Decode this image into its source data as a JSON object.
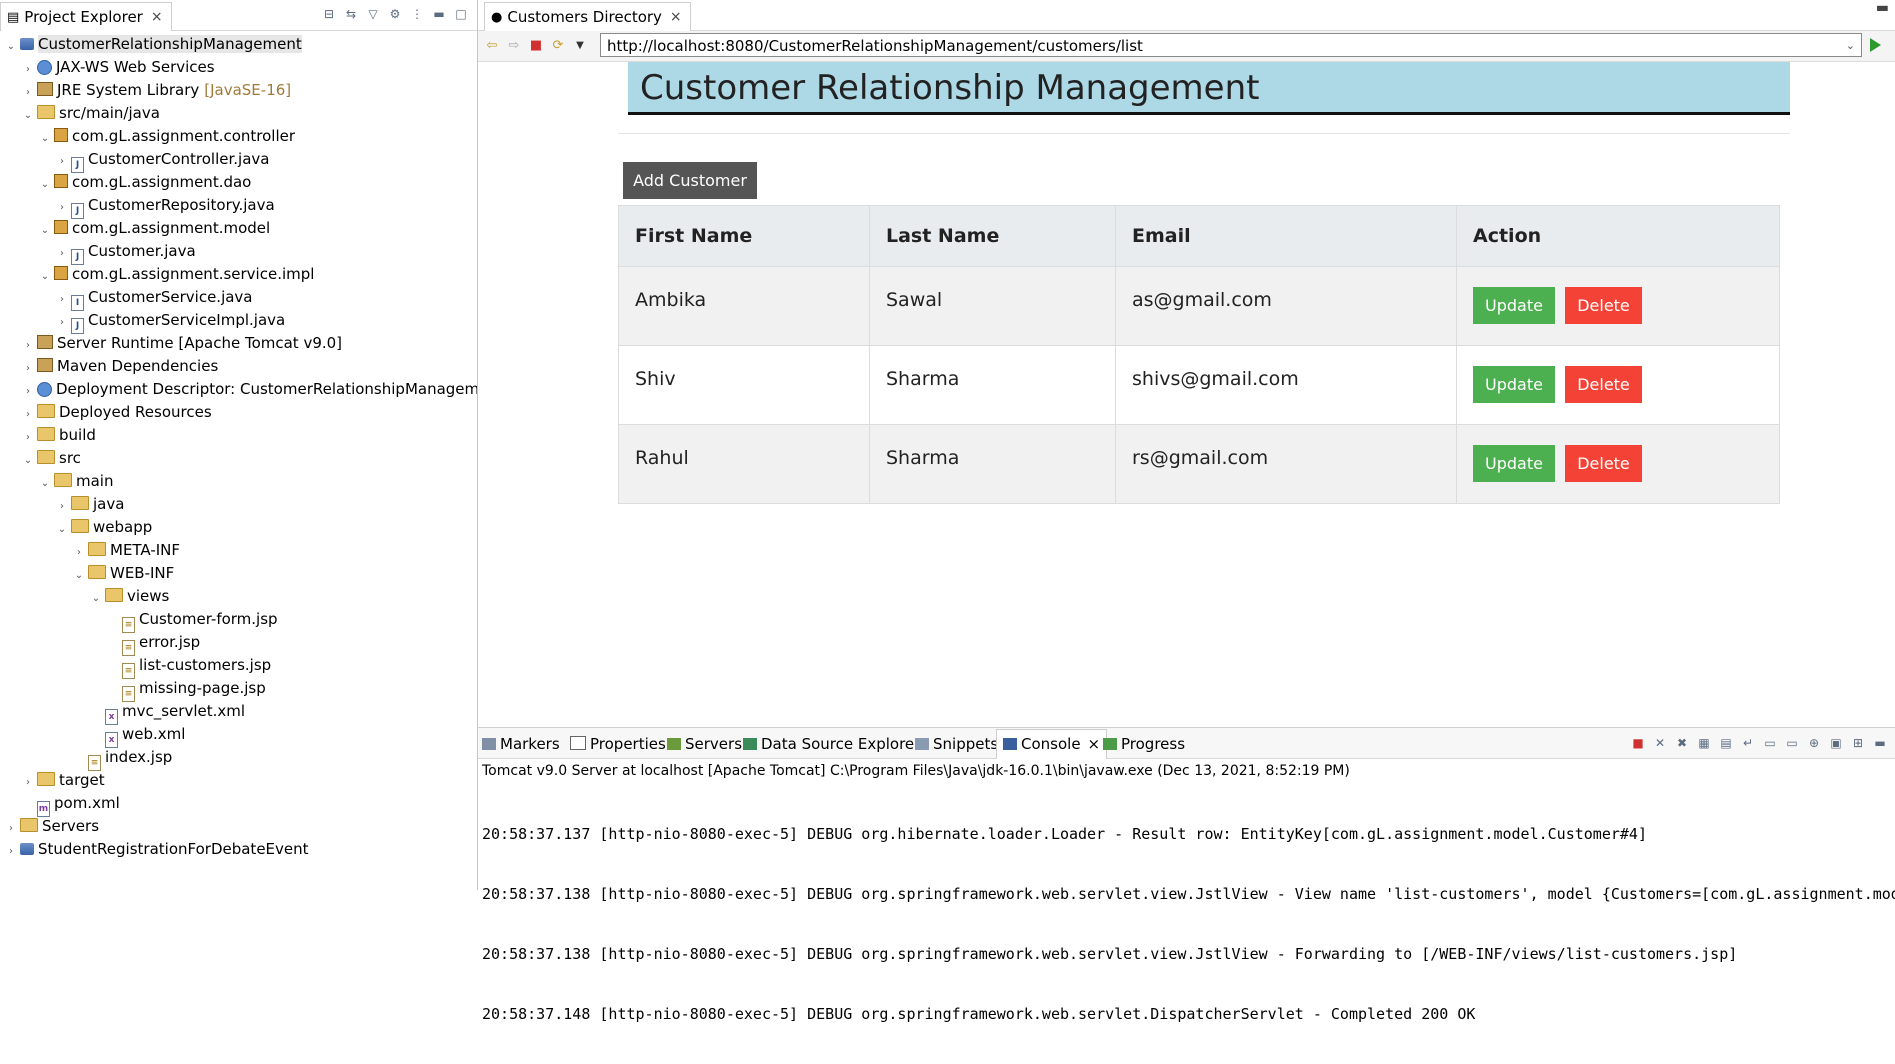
{
  "project_explorer": {
    "tab_label": "Project Explorer",
    "tree": [
      {
        "label": "CustomerRelationshipManagement",
        "icon": "project-icon",
        "level": 0,
        "twisty": "open",
        "selected": true
      },
      {
        "label": "JAX-WS Web Services",
        "icon": "webservice-icon",
        "level": 1,
        "twisty": "closed"
      },
      {
        "label": "JRE System Library",
        "deco": "[JavaSE-16]",
        "icon": "library-icon",
        "level": 1,
        "twisty": "closed"
      },
      {
        "label": "src/main/java",
        "icon": "source-folder-icon",
        "level": 1,
        "twisty": "open"
      },
      {
        "label": "com.gL.assignment.controller",
        "icon": "package-icon",
        "level": 2,
        "twisty": "open"
      },
      {
        "label": "CustomerController.java",
        "icon": "java-file-icon",
        "level": 3,
        "twisty": "closed"
      },
      {
        "label": "com.gL.assignment.dao",
        "icon": "package-icon",
        "level": 2,
        "twisty": "open"
      },
      {
        "label": "CustomerRepository.java",
        "icon": "java-file-icon",
        "level": 3,
        "twisty": "closed"
      },
      {
        "label": "com.gL.assignment.model",
        "icon": "package-icon",
        "level": 2,
        "twisty": "open"
      },
      {
        "label": "Customer.java",
        "icon": "java-file-icon",
        "level": 3,
        "twisty": "closed"
      },
      {
        "label": "com.gL.assignment.service.impl",
        "icon": "package-icon",
        "level": 2,
        "twisty": "open"
      },
      {
        "label": "CustomerService.java",
        "icon": "java-interface-icon",
        "level": 3,
        "twisty": "closed"
      },
      {
        "label": "CustomerServiceImpl.java",
        "icon": "java-file-icon",
        "level": 3,
        "twisty": "closed"
      },
      {
        "label": "Server Runtime [Apache Tomcat v9.0]",
        "icon": "library-icon",
        "level": 1,
        "twisty": "closed"
      },
      {
        "label": "Maven Dependencies",
        "icon": "library-icon",
        "level": 1,
        "twisty": "closed"
      },
      {
        "label": "Deployment Descriptor: CustomerRelationshipManagement",
        "icon": "descriptor-icon",
        "level": 1,
        "twisty": "closed"
      },
      {
        "label": "Deployed Resources",
        "icon": "folder-icon",
        "level": 1,
        "twisty": "closed"
      },
      {
        "label": "build",
        "icon": "folder-icon",
        "level": 1,
        "twisty": "closed"
      },
      {
        "label": "src",
        "icon": "folder-icon",
        "level": 1,
        "twisty": "open"
      },
      {
        "label": "main",
        "icon": "folder-icon",
        "level": 2,
        "twisty": "open"
      },
      {
        "label": "java",
        "icon": "folder-icon",
        "level": 3,
        "twisty": "closed"
      },
      {
        "label": "webapp",
        "icon": "folder-icon",
        "level": 3,
        "twisty": "open"
      },
      {
        "label": "META-INF",
        "icon": "folder-icon",
        "level": 4,
        "twisty": "closed"
      },
      {
        "label": "WEB-INF",
        "icon": "folder-icon",
        "level": 4,
        "twisty": "open"
      },
      {
        "label": "views",
        "icon": "folder-icon",
        "level": 5,
        "twisty": "open"
      },
      {
        "label": "Customer-form.jsp",
        "icon": "jsp-file-icon",
        "level": 6,
        "twisty": "none"
      },
      {
        "label": "error.jsp",
        "icon": "jsp-file-icon",
        "level": 6,
        "twisty": "none"
      },
      {
        "label": "list-customers.jsp",
        "icon": "jsp-file-icon",
        "level": 6,
        "twisty": "none"
      },
      {
        "label": "missing-page.jsp",
        "icon": "jsp-file-icon",
        "level": 6,
        "twisty": "none"
      },
      {
        "label": "mvc_servlet.xml",
        "icon": "xml-file-icon",
        "level": 5,
        "twisty": "none"
      },
      {
        "label": "web.xml",
        "icon": "xml-file-icon",
        "level": 5,
        "twisty": "none"
      },
      {
        "label": "index.jsp",
        "icon": "jsp-file-icon",
        "level": 4,
        "twisty": "none"
      },
      {
        "label": "target",
        "icon": "folder-icon",
        "level": 1,
        "twisty": "closed"
      },
      {
        "label": "pom.xml",
        "icon": "maven-pom-icon",
        "level": 1,
        "twisty": "none"
      },
      {
        "label": "Servers",
        "icon": "folder-icon",
        "level": 0,
        "twisty": "closed"
      },
      {
        "label": "StudentRegistrationForDebateEvent",
        "icon": "project-icon",
        "level": 0,
        "twisty": "closed"
      }
    ]
  },
  "editor": {
    "tab_label": "Customers Directory",
    "url": "http://localhost:8080/CustomerRelationshipManagement/customers/list"
  },
  "page": {
    "header_title": "Customer Relationship Management",
    "add_button": "Add Customer",
    "columns": [
      "First Name",
      "Last Name",
      "Email",
      "Action"
    ],
    "rows": [
      {
        "first": "Ambika",
        "last": "Sawal",
        "email": "as@gmail.com",
        "update": "Update",
        "delete": "Delete"
      },
      {
        "first": "Shiv",
        "last": "Sharma",
        "email": "shivs@gmail.com",
        "update": "Update",
        "delete": "Delete"
      },
      {
        "first": "Rahul",
        "last": "Sharma",
        "email": "rs@gmail.com",
        "update": "Update",
        "delete": "Delete"
      }
    ],
    "colors": {
      "header_bg": "#add8e6",
      "update": "#4caf50",
      "delete": "#f44336",
      "add": "#555555"
    }
  },
  "bottom_panel": {
    "tabs": [
      "Markers",
      "Properties",
      "Servers",
      "Data Source Explorer",
      "Snippets",
      "Console",
      "Progress"
    ],
    "active_tab": "Console",
    "console_description": "Tomcat v9.0 Server at localhost [Apache Tomcat] C:\\Program Files\\Java\\jdk-16.0.1\\bin\\javaw.exe  (Dec 13, 2021, 8:52:19 PM)",
    "log_lines": [
      "20:58:37.137 [http-nio-8080-exec-5] DEBUG org.hibernate.loader.Loader - Result row: EntityKey[com.gL.assignment.model.Customer#4]",
      "20:58:37.138 [http-nio-8080-exec-5] DEBUG org.springframework.web.servlet.view.JstlView - View name 'list-customers', model {Customers=[com.gL.assignment.mod",
      "20:58:37.138 [http-nio-8080-exec-5] DEBUG org.springframework.web.servlet.view.JstlView - Forwarding to [/WEB-INF/views/list-customers.jsp]",
      "20:58:37.148 [http-nio-8080-exec-5] DEBUG org.springframework.web.servlet.DispatcherServlet - Completed 200 OK"
    ]
  }
}
